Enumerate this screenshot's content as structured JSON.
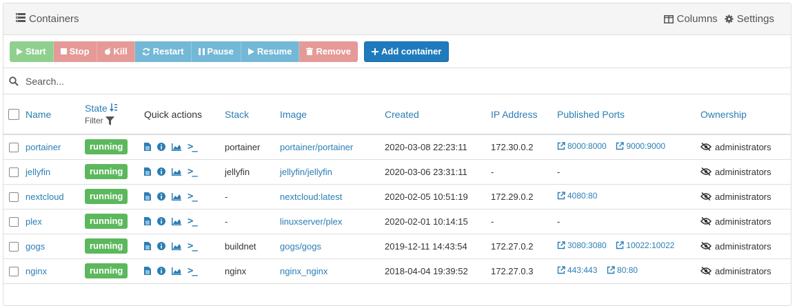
{
  "header": {
    "title": "Containers",
    "columns_label": "Columns",
    "settings_label": "Settings"
  },
  "toolbar": {
    "start": "Start",
    "stop": "Stop",
    "kill": "Kill",
    "restart": "Restart",
    "pause": "Pause",
    "resume": "Resume",
    "remove": "Remove",
    "add": "Add container"
  },
  "search": {
    "placeholder": "Search..."
  },
  "columns": {
    "name": "Name",
    "state": "State",
    "filter": "Filter",
    "quick_actions": "Quick actions",
    "stack": "Stack",
    "image": "Image",
    "created": "Created",
    "ip": "IP Address",
    "ports": "Published Ports",
    "ownership": "Ownership"
  },
  "rows": [
    {
      "name": "portainer",
      "state": "running",
      "stack": "portainer",
      "image": "portainer/portainer",
      "created": "2020-03-08 22:23:11",
      "ip": "172.30.0.2",
      "port1": "8000:8000",
      "port2": "9000:9000",
      "ports_dash": "",
      "ownership": "administrators"
    },
    {
      "name": "jellyfin",
      "state": "running",
      "stack": "jellyfin",
      "image": "jellyfin/jellyfin",
      "created": "2020-03-06 23:31:11",
      "ip": "-",
      "port1": "",
      "port2": "",
      "ports_dash": "-",
      "ownership": "administrators"
    },
    {
      "name": "nextcloud",
      "state": "running",
      "stack": "-",
      "image": "nextcloud:latest",
      "created": "2020-02-05 10:51:19",
      "ip": "172.29.0.2",
      "port1": "4080:80",
      "port2": "",
      "ports_dash": "",
      "ownership": "administrators"
    },
    {
      "name": "plex",
      "state": "running",
      "stack": "-",
      "image": "linuxserver/plex",
      "created": "2020-02-01 10:14:15",
      "ip": "-",
      "port1": "",
      "port2": "",
      "ports_dash": "-",
      "ownership": "administrators"
    },
    {
      "name": "gogs",
      "state": "running",
      "stack": "buildnet",
      "image": "gogs/gogs",
      "created": "2019-12-11 14:43:54",
      "ip": "172.27.0.2",
      "port1": "3080:3080",
      "port2": "10022:10022",
      "ports_dash": "",
      "ownership": "administrators"
    },
    {
      "name": "nginx",
      "state": "running",
      "stack": "nginx",
      "image": "nginx_nginx",
      "created": "2018-04-04 19:39:52",
      "ip": "172.27.0.3",
      "port1": "443:443",
      "port2": "80:80",
      "ports_dash": "",
      "ownership": "administrators"
    }
  ],
  "colors": {
    "link": "#2a7eb5",
    "running": "#5cb85c",
    "primary": "#1f7bbd"
  }
}
